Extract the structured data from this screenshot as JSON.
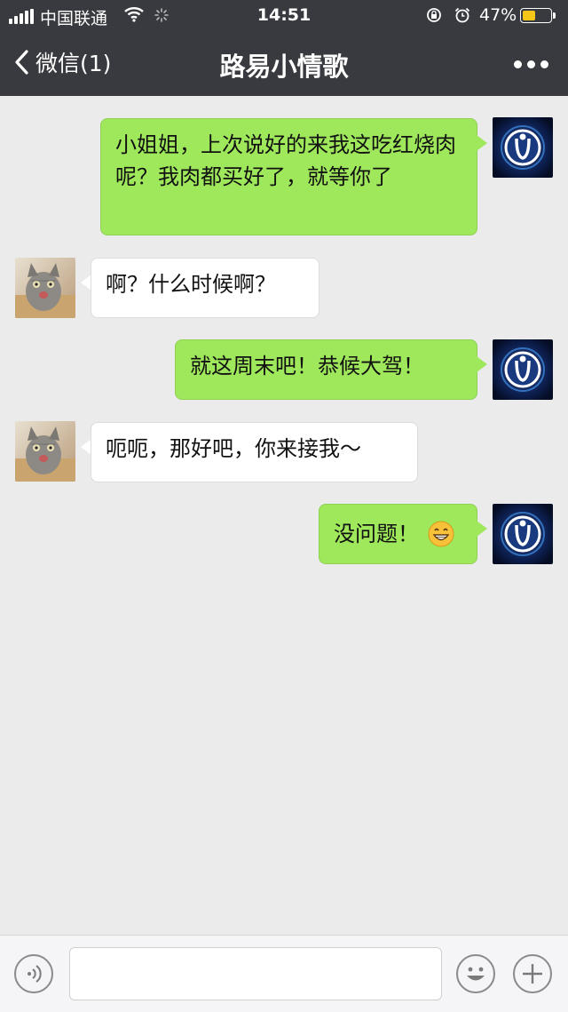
{
  "status_bar": {
    "carrier": "中国联通",
    "time": "14:51",
    "battery_percent": "47%",
    "battery_level": 0.47
  },
  "nav": {
    "back_label": "微信(1)",
    "title": "路易小情歌"
  },
  "messages": [
    {
      "sender": "me",
      "text": "小姐姐，上次说好的来我这吃红烧肉呢？我肉都买好了，就等你了"
    },
    {
      "sender": "other",
      "text": "啊？什么时候啊？"
    },
    {
      "sender": "me",
      "text": "就这周末吧！恭候大驾！"
    },
    {
      "sender": "other",
      "text": "呃呃，那好吧，你来接我～"
    },
    {
      "sender": "me",
      "text": "没问题！",
      "emoji": "grin-emoji"
    }
  ],
  "input_bar": {
    "voice_icon": "voice-icon",
    "emoji_icon": "emoji-icon",
    "plus_icon": "plus-icon",
    "text_value": ""
  },
  "colors": {
    "nav_bg": "#393a3f",
    "my_bubble": "#9fe85c",
    "other_bubble": "#ffffff",
    "chat_bg": "#ebebeb"
  }
}
